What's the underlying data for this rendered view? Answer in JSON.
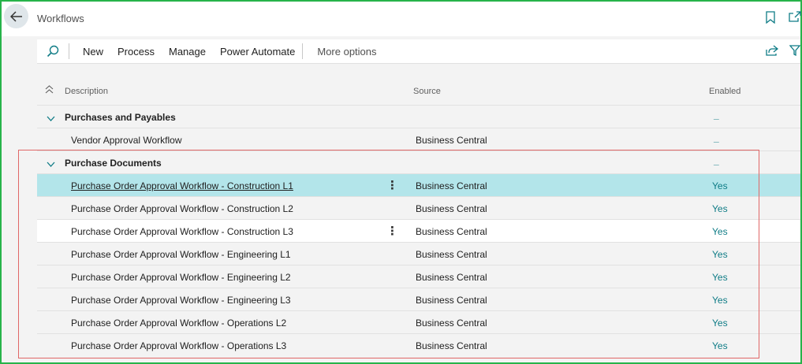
{
  "header": {
    "title": "Workflows"
  },
  "actions": {
    "items": [
      "New",
      "Process",
      "Manage",
      "Power Automate"
    ],
    "more": "More options"
  },
  "columns": {
    "description": "Description",
    "source": "Source",
    "enabled": "Enabled"
  },
  "groups": [
    {
      "name": "Purchases and Payables",
      "enabled": "_",
      "rows": [
        {
          "description": "Vendor Approval Workflow",
          "source": "Business Central",
          "enabled": "_"
        }
      ]
    },
    {
      "name": "Purchase Documents",
      "enabled": "_",
      "rows": [
        {
          "description": "Purchase Order Approval Workflow - Construction L1",
          "source": "Business Central",
          "enabled": "Yes"
        },
        {
          "description": "Purchase Order Approval Workflow - Construction L2",
          "source": "Business Central",
          "enabled": "Yes"
        },
        {
          "description": "Purchase Order Approval Workflow - Construction L3",
          "source": "Business Central",
          "enabled": "Yes"
        },
        {
          "description": "Purchase Order Approval Workflow - Engineering L1",
          "source": "Business Central",
          "enabled": "Yes"
        },
        {
          "description": "Purchase Order Approval Workflow - Engineering L2",
          "source": "Business Central",
          "enabled": "Yes"
        },
        {
          "description": "Purchase Order Approval Workflow - Engineering L3",
          "source": "Business Central",
          "enabled": "Yes"
        },
        {
          "description": "Purchase Order Approval Workflow - Operations L2",
          "source": "Business Central",
          "enabled": "Yes"
        },
        {
          "description": "Purchase Order Approval Workflow - Operations L3",
          "source": "Business Central",
          "enabled": "Yes"
        }
      ]
    }
  ],
  "colors": {
    "frame": "#27b34a",
    "accent": "#0f7c86",
    "selected_row": "#b3e5ea",
    "highlight_box": "#e06767"
  }
}
